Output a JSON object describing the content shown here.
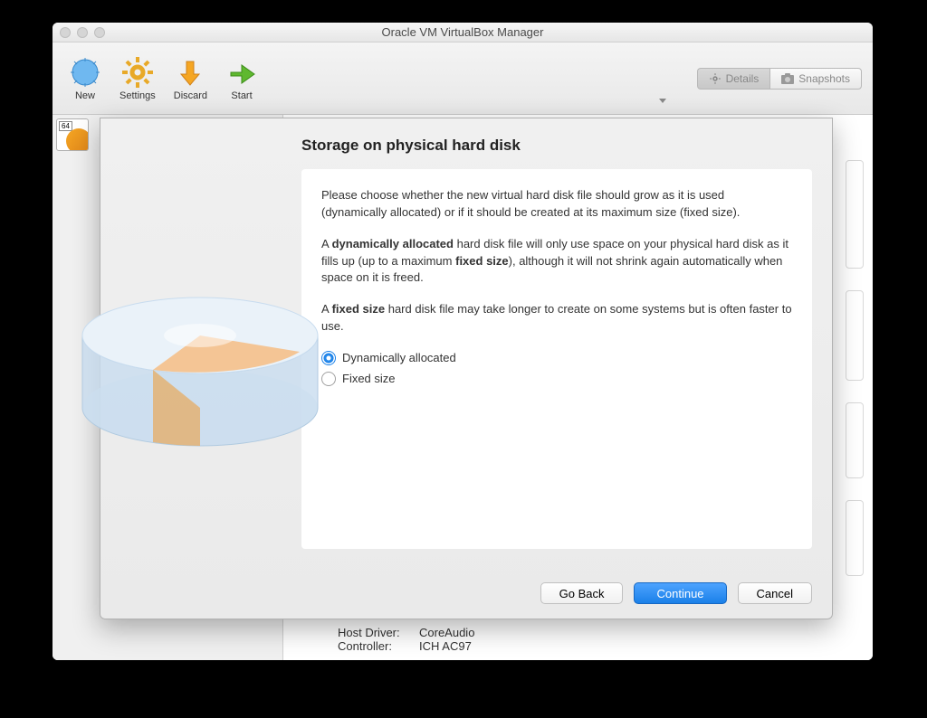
{
  "window": {
    "title": "Oracle VM VirtualBox Manager"
  },
  "toolbar": {
    "new": "New",
    "settings": "Settings",
    "discard": "Discard",
    "start": "Start"
  },
  "tabs": {
    "details": "Details",
    "snapshots": "Snapshots"
  },
  "vm_badge": "64",
  "audio": {
    "host_driver_label": "Host Driver:",
    "host_driver_value": "CoreAudio",
    "controller_label": "Controller:",
    "controller_value": "ICH AC97"
  },
  "dialog": {
    "title": "Storage on physical hard disk",
    "intro": "Please choose whether the new virtual hard disk file should grow as it is used (dynamically allocated) or if it should be created at its maximum size (fixed size).",
    "dyn_a": "A ",
    "dyn_b": "dynamically allocated",
    "dyn_c": " hard disk file will only use space on your physical hard disk as it fills up (up to a maximum ",
    "dyn_d": "fixed size",
    "dyn_e": "), although it will not shrink again automatically when space on it is freed.",
    "fix_a": "A ",
    "fix_b": "fixed size",
    "fix_c": " hard disk file may take longer to create on some systems but is often faster to use.",
    "option_dynamic": "Dynamically allocated",
    "option_fixed": "Fixed size",
    "go_back": "Go Back",
    "continue": "Continue",
    "cancel": "Cancel"
  }
}
